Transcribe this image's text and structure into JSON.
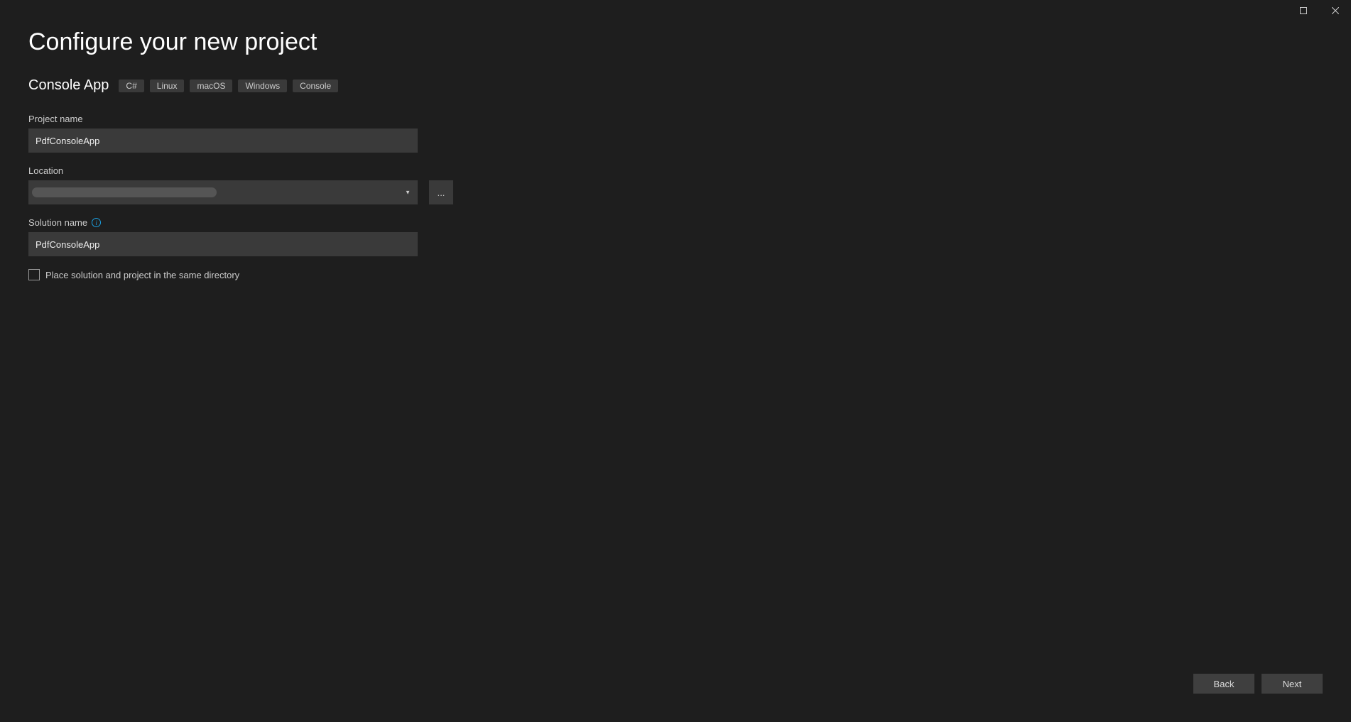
{
  "window": {
    "maximize_label": "Maximize",
    "close_label": "Close"
  },
  "page": {
    "title": "Configure your new project"
  },
  "template": {
    "name": "Console App",
    "tags": [
      "C#",
      "Linux",
      "macOS",
      "Windows",
      "Console"
    ]
  },
  "fields": {
    "project_name": {
      "label": "Project name",
      "value": "PdfConsoleApp"
    },
    "location": {
      "label": "Location",
      "value": "",
      "browse_label": "..."
    },
    "solution_name": {
      "label": "Solution name",
      "value": "PdfConsoleApp",
      "info_tooltip": "i"
    },
    "same_dir_checkbox": {
      "label": "Place solution and project in the same directory",
      "checked": false
    }
  },
  "footer": {
    "back_label": "Back",
    "next_label": "Next"
  }
}
